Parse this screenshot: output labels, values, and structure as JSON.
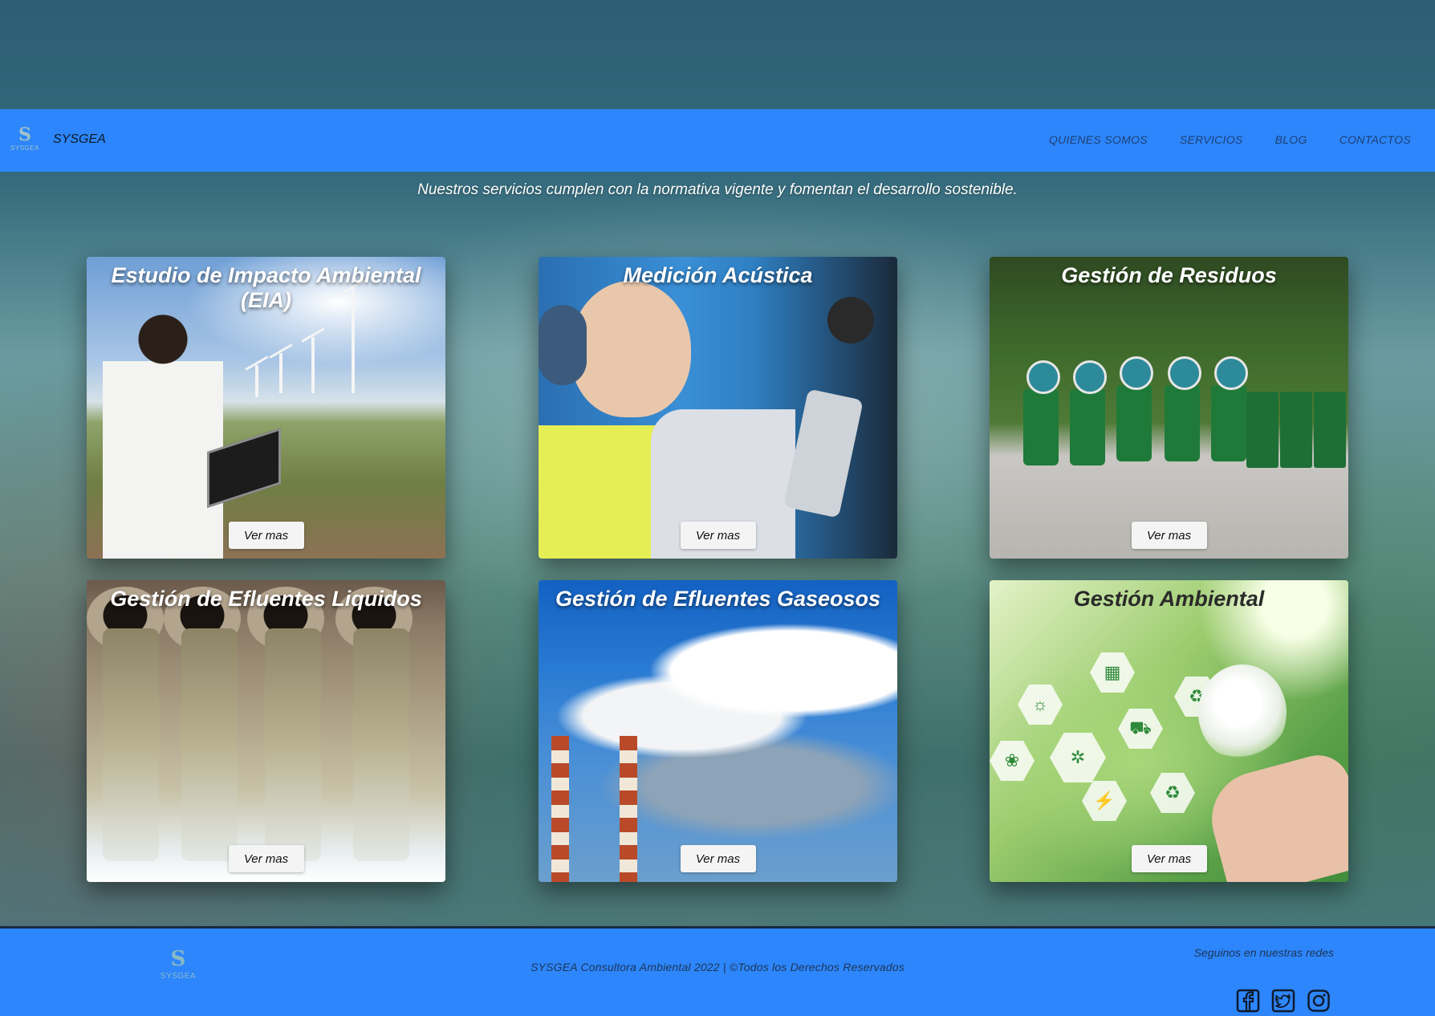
{
  "nav": {
    "brand": "SYSGEA",
    "logo_text": "SYSGEA",
    "logo_glyph": "S",
    "links": [
      "QUIENES SOMOS",
      "SERVICIOS",
      "BLOG",
      "CONTACTOS"
    ]
  },
  "tagline": "Nuestros servicios cumplen con la normativa vigente y fomentan el desarrollo sostenible.",
  "services": [
    {
      "title": "Estudio de Impacto Ambiental (EIA)",
      "button": "Ver mas"
    },
    {
      "title": "Medición Acústica",
      "button": "Ver mas"
    },
    {
      "title": "Gestión de Residuos",
      "button": "Ver mas"
    },
    {
      "title": "Gestión de Efluentes Liquidos",
      "button": "Ver mas"
    },
    {
      "title": "Gestión de Efluentes Gaseosos",
      "button": "Ver mas"
    },
    {
      "title": "Gestión Ambiental",
      "button": "Ver mas"
    }
  ],
  "footer": {
    "logo_text": "SYSGEA",
    "logo_glyph": "S",
    "copyright": "SYSGEA Consultora Ambiental 2022 | ©Todos los Derechos Reservados",
    "social_label": "Seguinos en nuestras redes",
    "social_icons": [
      "facebook-icon",
      "twitter-icon",
      "instagram-icon"
    ]
  },
  "colors": {
    "navbar": "#2d86fb",
    "footer": "#2d86fb",
    "button_bg": "#f4f4f4"
  }
}
